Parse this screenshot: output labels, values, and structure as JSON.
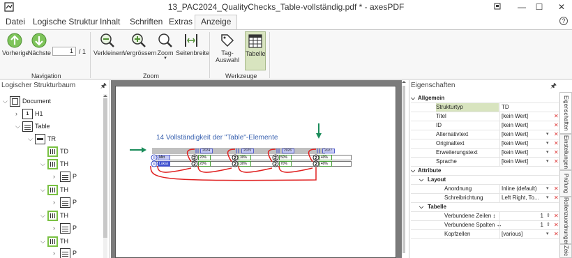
{
  "window": {
    "title": "13_PAC2024_QualityChecks_Table-vollständig.pdf * - axesPDF",
    "controls": [
      "restore-down",
      "minimize",
      "maximize",
      "close"
    ]
  },
  "menu": {
    "tabs": [
      "Datei",
      "Logische Struktur",
      "Inhalt",
      "Schriften",
      "Extras",
      "Anzeige"
    ],
    "active": "Anzeige"
  },
  "ribbon": {
    "navigation": {
      "prev_label": "Vorherige",
      "next_label": "Nächste",
      "page_value": "1",
      "page_total": "/ 1",
      "group_label": "Navigation"
    },
    "zoom": {
      "zoom_out_label": "Verkleinern",
      "zoom_in_label": "Vergrössern",
      "zoom_label": "Zoom",
      "fit_width_label": "Seitenbreite",
      "group_label": "Zoom"
    },
    "tools": {
      "tag_select_label": "Tag-Auswahl",
      "table_label": "Tabelle",
      "group_label": "Werkzeuge"
    }
  },
  "left_panel": {
    "title": "Logischer Strukturbaum",
    "items": [
      {
        "label": "Document"
      },
      {
        "label": "H1"
      },
      {
        "label": "Table"
      },
      {
        "label": "TR"
      },
      {
        "label": "TD"
      },
      {
        "label": "TH"
      },
      {
        "label": "P"
      },
      {
        "label": "TH"
      },
      {
        "label": "P"
      },
      {
        "label": "TH"
      },
      {
        "label": "P"
      },
      {
        "label": "TH"
      },
      {
        "label": "P"
      }
    ]
  },
  "document": {
    "heading": "14 Vollständigkeit der \"Table\"-Elemente",
    "header_cells": [
      "2024",
      "2025",
      "2026",
      "2027"
    ],
    "row1_label": "Mitt",
    "row2_label": "Lukas",
    "row1_values": [
      "20%",
      "30%",
      "50%",
      "40%"
    ],
    "row2_values": [
      "20%",
      "30%",
      "70%",
      "40%"
    ],
    "arrow_color": "#1a8c5a",
    "link_color": "#e02020"
  },
  "right_panel": {
    "title": "Eigenschaften",
    "sections": {
      "general": "Allgemein",
      "attributes": "Attribute",
      "layout": "Layout",
      "table": "Tabelle"
    },
    "props": {
      "structtype_name": "Strukturtyp",
      "structtype_val": "TD",
      "title_name": "Titel",
      "title_val": "[kein Wert]",
      "id_name": "ID",
      "id_val": "[kein Wert]",
      "alt_name": "Alternativtext",
      "alt_val": "[kein Wert]",
      "orig_name": "Originaltext",
      "orig_val": "[kein Wert]",
      "ext_name": "Erweiterungstext",
      "ext_val": "[kein Wert]",
      "lang_name": "Sprache",
      "lang_val": "[kein Wert]",
      "place_name": "Anordnung",
      "place_val": "Inline (default)",
      "wmode_name": "Schreibrichtung",
      "wmode_val": "Left Right, To...",
      "rowspan_name": "Verbundene Zeilen ↕",
      "rowspan_val": "1",
      "colspan_name": "Verbundene Spalten ↔",
      "colspan_val": "1",
      "headers_name": "Kopfzellen",
      "headers_val": "[various]"
    },
    "side_tabs": [
      "Eigenschaften",
      "Einstellungen",
      "Prüfung",
      "Rollenzuordnungen",
      "Zeic"
    ]
  }
}
